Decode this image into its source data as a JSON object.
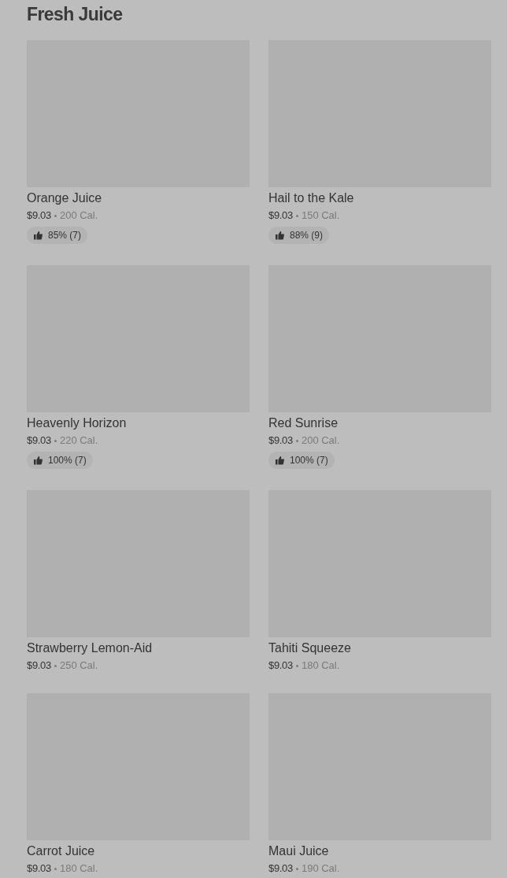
{
  "section": {
    "title": "Fresh Juice"
  },
  "items": [
    {
      "name": "Orange Juice",
      "price": "$9.03",
      "calories": "200 Cal.",
      "rating": "85% (7)"
    },
    {
      "name": "Hail to the Kale",
      "price": "$9.03",
      "calories": "150 Cal.",
      "rating": "88% (9)"
    },
    {
      "name": "Heavenly Horizon",
      "price": "$9.03",
      "calories": "220 Cal.",
      "rating": "100% (7)"
    },
    {
      "name": "Red Sunrise",
      "price": "$9.03",
      "calories": "200 Cal.",
      "rating": "100% (7)"
    },
    {
      "name": "Strawberry Lemon-Aid",
      "price": "$9.03",
      "calories": "250 Cal."
    },
    {
      "name": "Tahiti Squeeze",
      "price": "$9.03",
      "calories": "180 Cal."
    },
    {
      "name": "Carrot Juice",
      "price": "$9.03",
      "calories": "180 Cal."
    },
    {
      "name": "Maui Juice",
      "price": "$9.03",
      "calories": "190 Cal."
    }
  ]
}
